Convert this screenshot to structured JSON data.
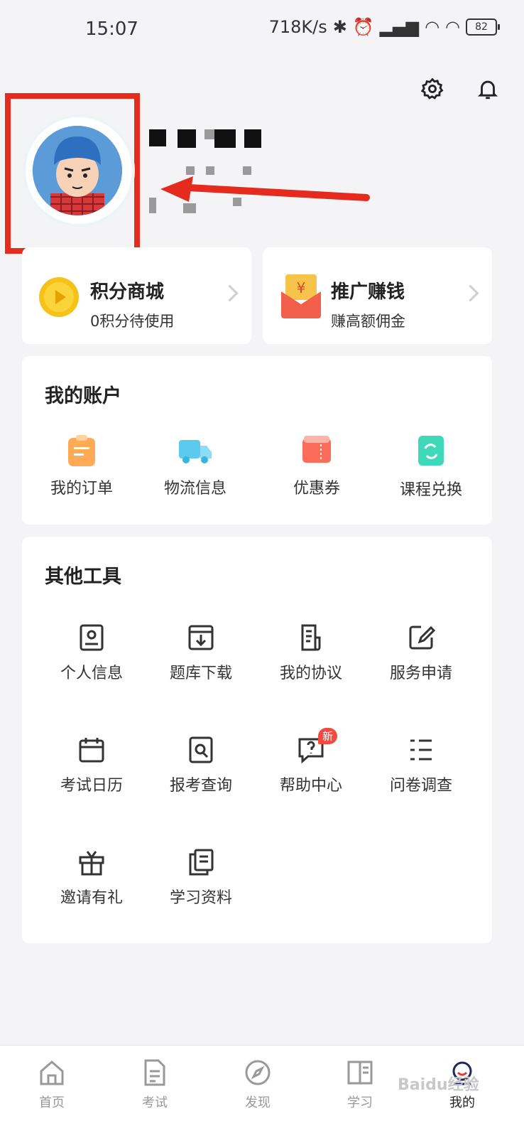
{
  "status_bar": {
    "time": "15:07",
    "speed": "718K/s",
    "battery": "82"
  },
  "header": {
    "settings_icon": "gear-icon",
    "bell_icon": "bell-icon"
  },
  "promo": [
    {
      "title": "积分商城",
      "subtitle": "0积分待使用",
      "icon": "play-coin-icon"
    },
    {
      "title": "推广赚钱",
      "subtitle": "赚高额佣金",
      "icon": "red-envelope-icon"
    }
  ],
  "account": {
    "title": "我的账户",
    "items": [
      {
        "label": "我的订单",
        "icon": "order-icon"
      },
      {
        "label": "物流信息",
        "icon": "truck-icon"
      },
      {
        "label": "优惠券",
        "icon": "coupon-icon"
      },
      {
        "label": "课程兑换",
        "icon": "exchange-icon"
      }
    ]
  },
  "tools": {
    "title": "其他工具",
    "items": [
      {
        "label": "个人信息",
        "icon": "id-card-icon"
      },
      {
        "label": "题库下载",
        "icon": "download-box-icon"
      },
      {
        "label": "我的协议",
        "icon": "agreement-icon"
      },
      {
        "label": "服务申请",
        "icon": "edit-icon"
      },
      {
        "label": "考试日历",
        "icon": "calendar-icon"
      },
      {
        "label": "报考查询",
        "icon": "search-doc-icon"
      },
      {
        "label": "帮助中心",
        "icon": "help-chat-icon",
        "badge": "新"
      },
      {
        "label": "问卷调查",
        "icon": "list-icon"
      },
      {
        "label": "邀请有礼",
        "icon": "gift-icon"
      },
      {
        "label": "学习资料",
        "icon": "documents-icon"
      }
    ]
  },
  "tabbar": [
    {
      "label": "首页",
      "icon": "home-icon"
    },
    {
      "label": "考试",
      "icon": "exam-icon"
    },
    {
      "label": "发现",
      "icon": "compass-icon"
    },
    {
      "label": "学习",
      "icon": "book-icon"
    },
    {
      "label": "我的",
      "icon": "profile-icon",
      "active": true
    }
  ],
  "watermark": "Baidu经验",
  "colors": {
    "highlight": "#e52a1e",
    "accent_red": "#f24a3f",
    "card_bg": "#ffffff",
    "page_bg": "#f4f4f6"
  }
}
